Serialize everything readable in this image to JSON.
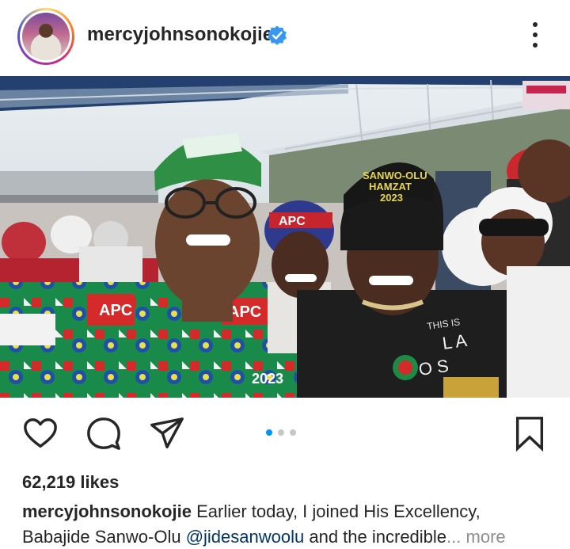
{
  "post": {
    "username": "mercyjohnsonokojie",
    "likes": "62,219 likes",
    "caption": {
      "username": "mercyjohnsonokojie",
      "text_1": "Earlier today, I joined His Excellency,",
      "text_2": "Babajide Sanwo-Olu",
      "mention": "@jidesanwoolu",
      "text_3": "and the incredible",
      "ellipsis": "...",
      "more": "more"
    },
    "carousel": {
      "count": 3,
      "active_index": 0
    }
  },
  "photo": {
    "cap_text": [
      "SANWO-OLU",
      "HAMZAT",
      "2023"
    ],
    "shirt_text": [
      "THIS IS",
      "L A",
      "O S"
    ],
    "headscarf_text": "APC",
    "agbada_labels": [
      "APC",
      "APC"
    ],
    "agbada_year": "2023"
  },
  "colors": {
    "accent_blue": "#0095f6",
    "verified_blue": "#3897f0",
    "mention": "#00376b",
    "muted": "#8e8e8e"
  },
  "icons": {
    "like": "heart-icon",
    "comment": "comment-icon",
    "share": "send-icon",
    "save": "bookmark-icon",
    "options": "more-options-icon",
    "verified": "verified-badge-icon"
  }
}
